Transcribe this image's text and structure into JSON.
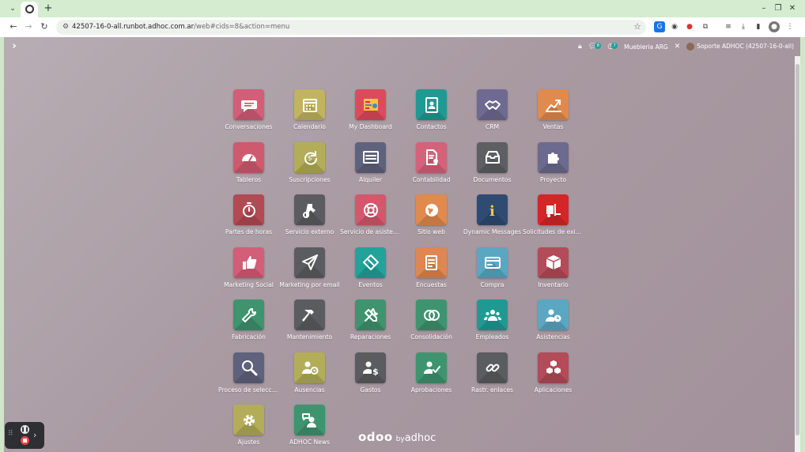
{
  "browser": {
    "url_host": "42507-16-0-all.runbot.adhoc.com.ar",
    "url_path": "/web#cids=8&action=menu",
    "new_tab_glyph": "+",
    "minimize_glyph": "–",
    "restore_glyph": "❐",
    "close_glyph": "✕"
  },
  "navbar": {
    "chat_badge": "8",
    "activity_badge": "7",
    "company": "Muebleria ARG",
    "user": "Soporte ADHOC (42507-16-0-all)"
  },
  "apps": [
    {
      "label": "Conversaciones",
      "color": "#d35e78",
      "icon": "chat-icon"
    },
    {
      "label": "Calendario",
      "color": "#c1b35f",
      "icon": "calendar-icon"
    },
    {
      "label": "My Dashboard",
      "color": "#dd4a5c",
      "icon": "dashboard-icon"
    },
    {
      "label": "Contactos",
      "color": "#1f9a93",
      "icon": "contacts-icon"
    },
    {
      "label": "CRM",
      "color": "#6f6a91",
      "icon": "handshake-icon"
    },
    {
      "label": "Ventas",
      "color": "#e08a4e",
      "icon": "chart-up-icon"
    },
    {
      "label": "Tableros",
      "color": "#cf5a6f",
      "icon": "gauge-icon"
    },
    {
      "label": "Suscripciones",
      "color": "#b3ad5a",
      "icon": "refresh-dollar-icon"
    },
    {
      "label": "Alquiler",
      "color": "#5f627c",
      "icon": "keyboard-icon"
    },
    {
      "label": "Contabilidad",
      "color": "#d2637a",
      "icon": "document-gear-icon"
    },
    {
      "label": "Documentos",
      "color": "#5d5f63",
      "icon": "inbox-icon"
    },
    {
      "label": "Proyecto",
      "color": "#6c6a8e",
      "icon": "puzzle-icon"
    },
    {
      "label": "Partes de horas",
      "color": "#b24a53",
      "icon": "stopwatch-icon"
    },
    {
      "label": "Servicio externo",
      "color": "#5b5c5f",
      "icon": "field-service-icon"
    },
    {
      "label": "Servicio de asistencia",
      "color": "#d4576c",
      "icon": "lifebuoy-icon"
    },
    {
      "label": "Sitio web",
      "color": "#e08a4e",
      "icon": "globe-icon"
    },
    {
      "label": "Dynamic Messages",
      "color": "#2f4b72",
      "icon": "info-icon"
    },
    {
      "label": "Solicitudes de existencias",
      "color": "#d42626",
      "icon": "forklift-icon"
    },
    {
      "label": "Marketing Social",
      "color": "#d35e78",
      "icon": "thumbs-up-icon"
    },
    {
      "label": "Marketing por email",
      "color": "#5b5c5f",
      "icon": "paper-plane-icon"
    },
    {
      "label": "Eventos",
      "color": "#21a39a",
      "icon": "ticket-icon"
    },
    {
      "label": "Encuestas",
      "color": "#de8752",
      "icon": "survey-icon"
    },
    {
      "label": "Compra",
      "color": "#5aa7c2",
      "icon": "credit-card-icon"
    },
    {
      "label": "Inventario",
      "color": "#b34b58",
      "icon": "box-icon"
    },
    {
      "label": "Fabricación",
      "color": "#3f9470",
      "icon": "wrench-icon"
    },
    {
      "label": "Mantenimiento",
      "color": "#5b5c5f",
      "icon": "hammer-icon"
    },
    {
      "label": "Reparaciones",
      "color": "#3f9470",
      "icon": "tools-icon"
    },
    {
      "label": "Consolidación",
      "color": "#3f9470",
      "icon": "circles-icon"
    },
    {
      "label": "Empleados",
      "color": "#1f9a93",
      "icon": "users-icon"
    },
    {
      "label": "Asistencias",
      "color": "#5aa7c2",
      "icon": "user-clock-icon"
    },
    {
      "label": "Proceso de selección",
      "color": "#5f627c",
      "icon": "magnifier-icon"
    },
    {
      "label": "Ausencias",
      "color": "#b3ad5a",
      "icon": "user-gear-icon"
    },
    {
      "label": "Gastos",
      "color": "#5b5c5f",
      "icon": "user-dollar-icon"
    },
    {
      "label": "Aprobaciones",
      "color": "#3f9470",
      "icon": "user-check-icon"
    },
    {
      "label": "Rastr. enlaces",
      "color": "#5b5c5f",
      "icon": "link-icon"
    },
    {
      "label": "Aplicaciones",
      "color": "#b34b58",
      "icon": "cubes-icon"
    },
    {
      "label": "Ajustes",
      "color": "#b3ad5a",
      "icon": "gear-icon"
    },
    {
      "label": "ADHOC News",
      "color": "#3f9470",
      "icon": "user-chat-icon"
    }
  ],
  "footer": {
    "brand": "odoo",
    "by": "by",
    "partner": "adhoc"
  }
}
